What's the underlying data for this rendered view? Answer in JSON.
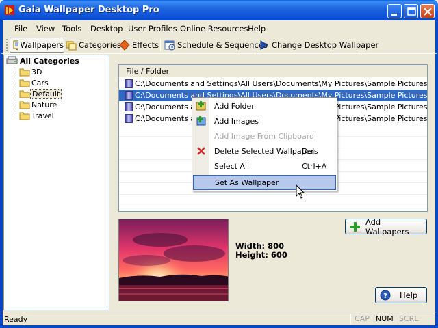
{
  "window": {
    "title": "Gaia Wallpaper Desktop Pro"
  },
  "menu": [
    {
      "label": "File"
    },
    {
      "label": "View"
    },
    {
      "label": "Tools"
    },
    {
      "label": "Desktop"
    },
    {
      "label": "User Profiles"
    },
    {
      "label": "Online Resources"
    },
    {
      "label": "Help"
    }
  ],
  "toolbar": {
    "wallpapers": "Wallpapers",
    "categories": "Categories",
    "effects": "Effects",
    "schedule": "Schedule & Sequences",
    "change": "Change Desktop Wallpaper"
  },
  "tree": {
    "root": "All Categories",
    "items": [
      "3D",
      "Cars",
      "Default",
      "Nature",
      "Travel"
    ],
    "selected": "Default"
  },
  "list": {
    "header": "File / Folder",
    "rows": [
      "C:\\Documents and Settings\\All Users\\Documents\\My Pictures\\Sample Pictures\\Blue h...",
      "C:\\Documents and Settings\\All Users\\Documents\\My Pictures\\Sample Pictures\\Sunse...",
      "C:\\Documents and Settings\\All Users\\Documents\\My Pictures\\Sample Pictures\\Water...",
      "C:\\Documents and Settings\\All Users\\Documents\\My Pictures\\Sample Pictures\\Winter..."
    ],
    "selected_index": 1
  },
  "context_menu": {
    "add_folder": "Add Folder",
    "add_images": "Add Images",
    "add_clipboard": "Add Image From Clipboard",
    "delete": "Delete Selected Wallpapers",
    "delete_shortcut": "Del",
    "select_all": "Select All",
    "select_all_shortcut": "Ctrl+A",
    "set_wallpaper": "Set As Wallpaper"
  },
  "preview": {
    "width_label": "Width: 800",
    "height_label": "Height: 600"
  },
  "buttons": {
    "add_wallpapers": "Add Wallpapers",
    "help": "Help"
  },
  "status": {
    "text": "Ready",
    "cap": "CAP",
    "num": "NUM",
    "scrl": "SCRL"
  },
  "colors": {
    "titlebar": "#0A48C4",
    "selection": "#316AC5",
    "menu_highlight": "#B6C9EC"
  }
}
